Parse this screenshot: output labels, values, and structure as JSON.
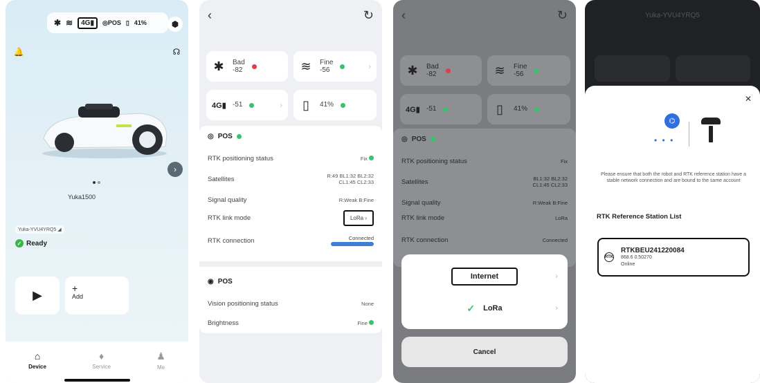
{
  "panel1": {
    "status": {
      "bt_icon": "bluetooth-icon",
      "wifi_icon": "wifi-icon",
      "signal_label": "4G",
      "pos_label": "POS",
      "battery": "41%"
    },
    "robot_name": "Yuka1500",
    "device_id": "Yuka-YVU4YRQ5",
    "status_text": "Ready",
    "add_label": "Add",
    "nav": {
      "device": "Device",
      "service": "Service",
      "me": "Me"
    }
  },
  "panel2": {
    "tiles": {
      "bt": {
        "quality": "Bad",
        "value": "-82"
      },
      "wifi": {
        "quality": "Fine",
        "value": "-56"
      },
      "cell": {
        "label": "4G",
        "value": "-51"
      },
      "battery": {
        "value": "41%"
      }
    },
    "pos_title": "POS",
    "rows": {
      "rtk_status": {
        "label": "RTK positioning status",
        "value": "Fix"
      },
      "satellites": {
        "label": "Satellites",
        "prefix": "R:49",
        "value_line1": "BL1:32 BL2:32",
        "value_line2": "CL1:45 CL2:33"
      },
      "signal": {
        "label": "Signal quality",
        "value": "R:Weak B:Fine"
      },
      "link_mode": {
        "label": "RTK link mode",
        "value": "LoRa"
      },
      "connection": {
        "label": "RTK connection",
        "value": "Connected"
      }
    },
    "vision_title": "POS",
    "vision_rows": {
      "vps": {
        "label": "Vision positioning status",
        "value": "None"
      },
      "brightness": {
        "label": "Brightness",
        "value": "Fine"
      }
    }
  },
  "panel3": {
    "option_internet": "Internet",
    "option_lora": "LoRa",
    "cancel": "Cancel"
  },
  "panel4": {
    "title": "Yuka-YVU4YRQ5",
    "info": "Please ensure that both the robot and RTK reference station have a stable network connection and are bound to the same account",
    "list_title": "RTK Reference Station List",
    "station": {
      "name": "RTKBEU241220084",
      "freq": "868.6 0.50270",
      "state": "Online"
    }
  }
}
